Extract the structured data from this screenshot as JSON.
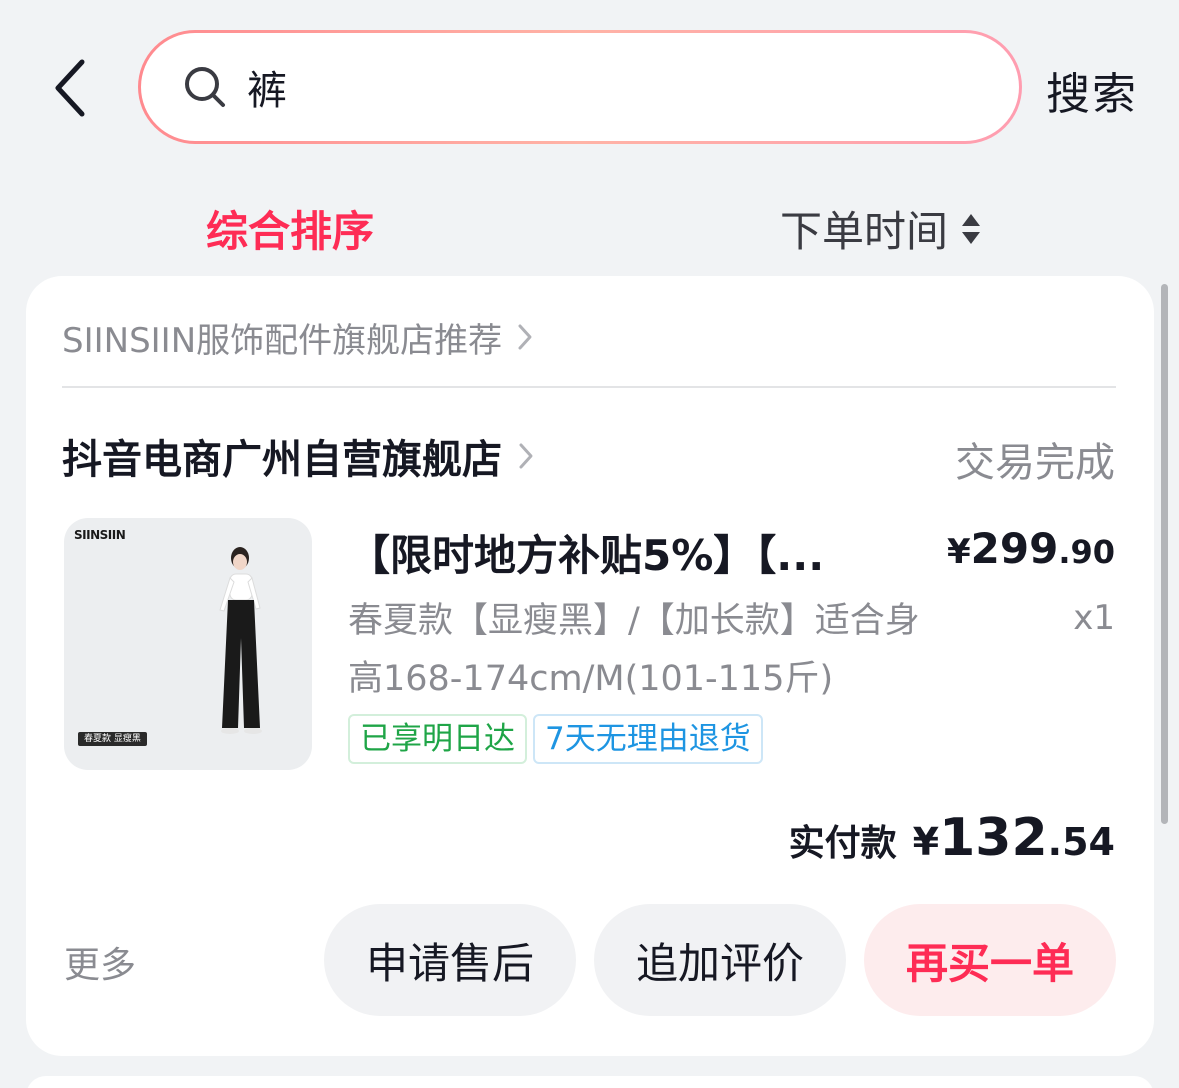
{
  "header": {
    "search_query": "裤",
    "search_button_label": "搜索"
  },
  "sort_tabs": {
    "comprehensive": "综合排序",
    "order_time": "下单时间"
  },
  "order": {
    "recommend_shop_label": "SIINSIIN服饰配件旗舰店推荐",
    "shop_name": "抖音电商广州自营旗舰店",
    "status": "交易完成",
    "product": {
      "image_brand": "SIINSIIN",
      "image_tag": "春夏款 显瘦黑",
      "title": "【限时地方补贴5%】【...",
      "price_symbol": "¥",
      "price_integer": "299",
      "price_decimal": ".90",
      "spec_line1": "春夏款【显瘦黑】/【加长款】适合身",
      "spec_line2": "高168-174cm/M(101-115斤)",
      "quantity": "x1",
      "badges": [
        "已享明日达",
        "7天无理由退货"
      ]
    },
    "paid": {
      "label": "实付款",
      "symbol": "¥",
      "integer": "132",
      "decimal": ".54"
    },
    "actions": {
      "more": "更多",
      "after_sale": "申请售后",
      "add_review": "追加评价",
      "buy_again": "再买一单"
    }
  },
  "colors": {
    "accent": "#fe2c55",
    "page_background": "#f1f3f5",
    "badge_green": "#1fa547",
    "badge_blue": "#1e95e2"
  },
  "icons": [
    "back-arrow-icon",
    "search-icon",
    "sort-arrows-icon",
    "chevron-right-icon"
  ]
}
